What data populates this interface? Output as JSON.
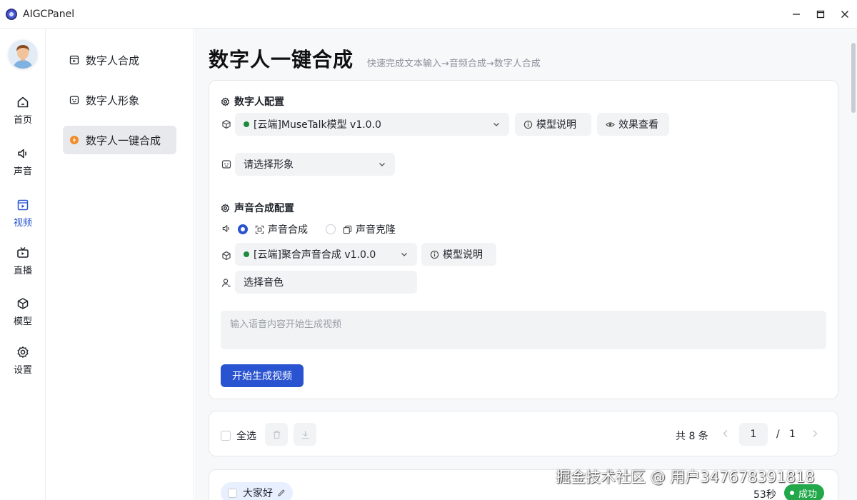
{
  "window": {
    "title": "AIGCPanel"
  },
  "leftnav": {
    "items": [
      {
        "label": "首页",
        "icon": "home-icon",
        "active": false
      },
      {
        "label": "声音",
        "icon": "speaker-icon",
        "active": false
      },
      {
        "label": "视频",
        "icon": "video-icon",
        "active": true
      },
      {
        "label": "直播",
        "icon": "tv-icon",
        "active": false
      },
      {
        "label": "模型",
        "icon": "cube-icon",
        "active": false
      },
      {
        "label": "设置",
        "icon": "gear-icon",
        "active": false
      }
    ]
  },
  "submenu": {
    "items": [
      {
        "label": "数字人合成",
        "icon": "video-frame-icon",
        "active": false
      },
      {
        "label": "数字人形象",
        "icon": "face-card-icon",
        "active": false
      },
      {
        "label": "数字人一键合成",
        "icon": "flash-icon",
        "active": true
      }
    ]
  },
  "page": {
    "title": "数字人一键合成",
    "subtitle": "快速完成文本输入→音频合成→数字人合成"
  },
  "digital_config": {
    "title": "数字人配置",
    "model_select": "[云端]MuseTalk模型 v1.0.0",
    "model_info_label": "模型说明",
    "effect_view_label": "效果查看",
    "avatar_select": "请选择形象"
  },
  "voice_config": {
    "title": "声音合成配置",
    "mode_tts_label": "声音合成",
    "mode_clone_label": "声音克隆",
    "selected_mode": "声音合成",
    "model_select": "[云端]聚合声音合成 v1.0.0",
    "model_info_label": "模型说明",
    "timbre_select": "选择音色"
  },
  "text_input": {
    "placeholder": "输入语音内容开始生成视频"
  },
  "actions": {
    "start_label": "开始生成视频"
  },
  "list_toolbar": {
    "select_all_label": "全选",
    "total_label": "共 8 条",
    "current_page": "1",
    "separator": "/",
    "total_pages": "1"
  },
  "task": {
    "title": "大家好",
    "duration": "53秒",
    "status": "成功"
  },
  "colors": {
    "accent": "#2953d0",
    "success": "#22a84a",
    "online_dot": "#1e8a3c"
  },
  "watermark": "掘金技术社区 @ 用户347678391818"
}
